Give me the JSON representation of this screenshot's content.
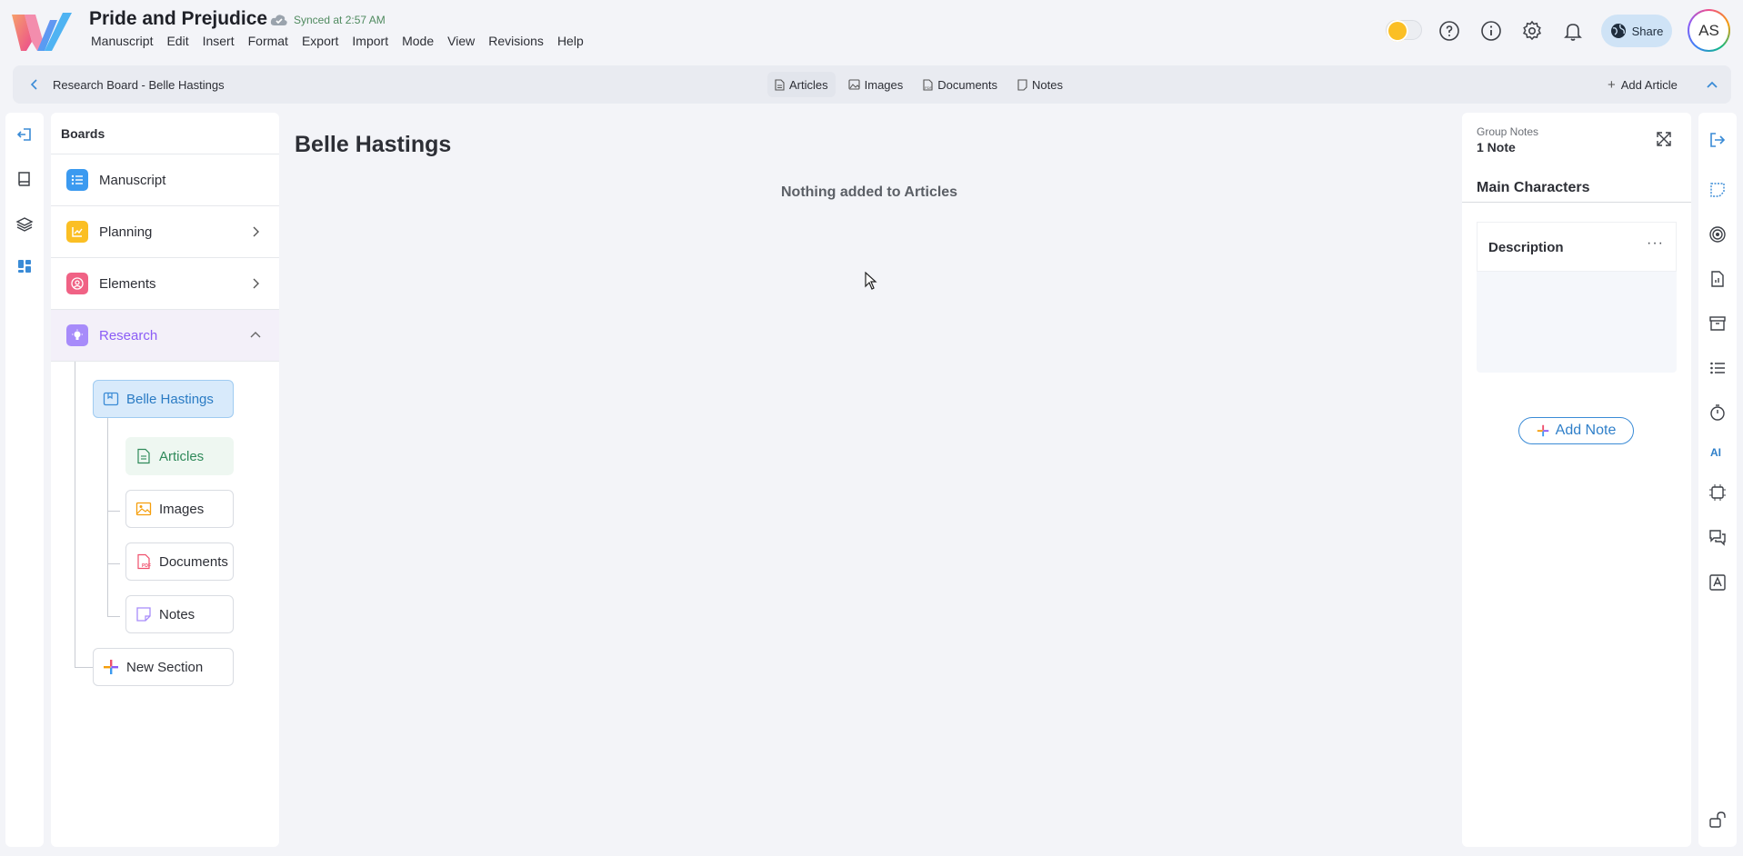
{
  "app": {
    "doc_title": "Pride and Prejudice",
    "sync_status": "Synced at 2:57 AM",
    "menu": [
      "Manuscript",
      "Edit",
      "Insert",
      "Format",
      "Export",
      "Import",
      "Mode",
      "View",
      "Revisions",
      "Help"
    ],
    "share_label": "Share",
    "avatar_initials": "AS",
    "icons": [
      "theme-toggle-icon",
      "help-icon",
      "info-icon",
      "settings-icon",
      "bell-icon",
      "globe-icon"
    ]
  },
  "subbar": {
    "breadcrumb": "Research Board - Belle Hastings",
    "tabs": [
      "Articles",
      "Images",
      "Documents",
      "Notes"
    ],
    "active_tab": "Articles",
    "add_article": "Add Article"
  },
  "boards": {
    "title": "Boards",
    "items": [
      {
        "label": "Manuscript",
        "color": "#3b9af0"
      },
      {
        "label": "Planning",
        "color": "#fbbf24"
      },
      {
        "label": "Elements",
        "color": "#f06285"
      },
      {
        "label": "Research",
        "color": "#a78bfa"
      }
    ],
    "research_children": {
      "section": "Belle Hastings",
      "sub": [
        "Articles",
        "Images",
        "Documents",
        "Notes"
      ],
      "new_section": "New Section"
    }
  },
  "main": {
    "title": "Belle Hastings",
    "empty_message": "Nothing added to Articles"
  },
  "notes": {
    "group_label": "Group Notes",
    "count": "1 Note",
    "group_title": "Main Characters",
    "card_title": "Description",
    "card_more": "···",
    "add_note": "Add Note"
  },
  "right_rail": {
    "ai_label": "AI"
  },
  "colors": {
    "accent": "#2f7fc9",
    "research": "#8b5cf6",
    "sync_green": "#4f8a5f"
  }
}
